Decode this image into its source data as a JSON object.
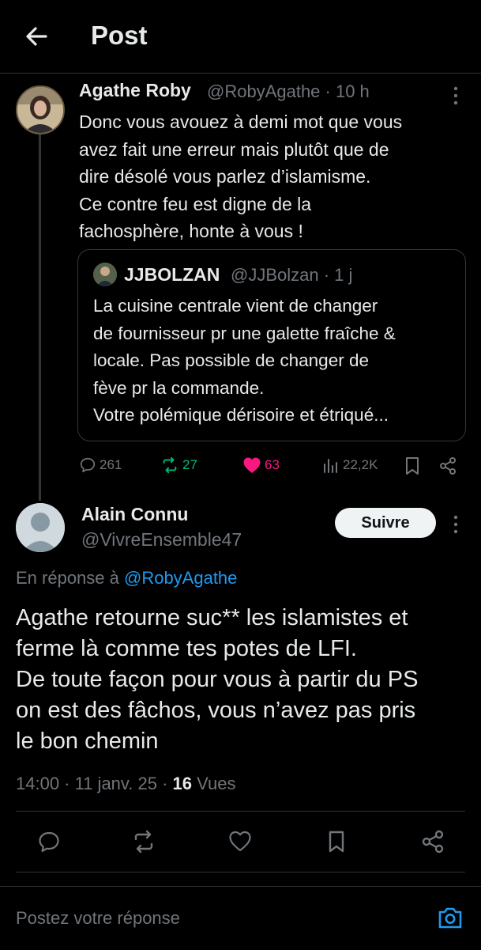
{
  "header": {
    "title": "Post"
  },
  "parent_post": {
    "author": "Agathe Roby",
    "handle_time": "@RobyAgathe · 10 h",
    "text": "Donc vous avouez à demi mot que vous\navez fait une erreur mais plutôt que de\ndire désolé vous parlez d’islamisme.\nCe contre feu est digne de la\nfachosphère, honte à vous !",
    "quote": {
      "author": "JJBOLZAN",
      "handle_time": "@JJBolzan · 1 j",
      "text": "La cuisine centrale vient de changer\nde fournisseur pr une galette fraîche &\nlocale. Pas possible de changer de\nfève  pr la commande.\nVotre polémique dérisoire et étriqué..."
    },
    "stats": {
      "replies": "261",
      "reposts": "27",
      "likes": "63",
      "views": "22,2K"
    },
    "colors": {
      "repost": "#00ba7c",
      "like": "#f91880",
      "muted": "#71767b"
    }
  },
  "main_post": {
    "author": "Alain Connu",
    "handle": "@VivreEnsemble47",
    "follow_label": "Suivre",
    "reply_prefix": "En réponse à ",
    "reply_mention": "@RobyAgathe",
    "text": "Agathe retourne suc** les islamistes et\nferme là comme tes potes de LFI.\nDe toute façon pour vous à partir du PS\non est des fâchos, vous n’avez pas pris\nle bon chemin",
    "time_date": "14:00 · 11 janv. 25 · ",
    "views_count": "16",
    "views_label": " Vues"
  },
  "reply_box": {
    "placeholder": "Postez votre réponse"
  },
  "accent": "#1d9bf0"
}
